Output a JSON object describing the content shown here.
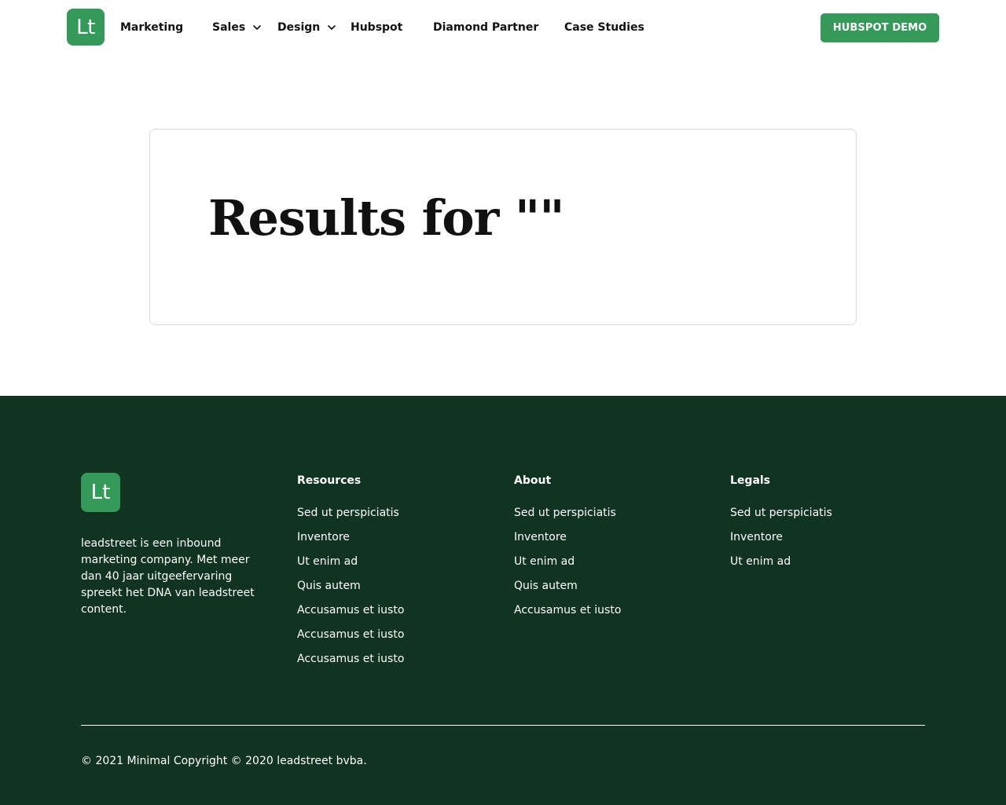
{
  "colors": {
    "brand_green": "#35995a",
    "footer_bg": "#113321",
    "text_dark": "#111111"
  },
  "header": {
    "logo_text": "Lt",
    "nav": [
      {
        "label": "Marketing",
        "has_dropdown": false
      },
      {
        "label": "Sales",
        "has_dropdown": true
      },
      {
        "label": "Design",
        "has_dropdown": true
      },
      {
        "label": "Hubspot",
        "has_dropdown": false
      },
      {
        "label": "Diamond Partner",
        "has_dropdown": false
      },
      {
        "label": "Case Studies",
        "has_dropdown": false
      }
    ],
    "cta_label": "HUBSPOT DEMO"
  },
  "main": {
    "results_title": "Results for \"\""
  },
  "footer": {
    "logo_text": "Lt",
    "about_text": "leadstreet is een inbound marketing company. Met meer dan 40 jaar uitgeefervaring spreekt het DNA van leadstreet content.",
    "columns": [
      {
        "title": "Resources",
        "links": [
          "Sed ut perspiciatis",
          "Inventore",
          "Ut enim ad",
          "Quis autem",
          "Accusamus et iusto",
          "Accusamus et iusto",
          "Accusamus et iusto"
        ]
      },
      {
        "title": "About",
        "links": [
          "Sed ut perspiciatis",
          "Inventore",
          "Ut enim ad",
          "Quis autem",
          "Accusamus et iusto"
        ]
      },
      {
        "title": "Legals",
        "links": [
          "Sed ut perspiciatis",
          "Inventore",
          "Ut enim ad"
        ]
      }
    ],
    "copyright": "© 2021 Minimal Copyright © 2020 leadstreet bvba."
  }
}
